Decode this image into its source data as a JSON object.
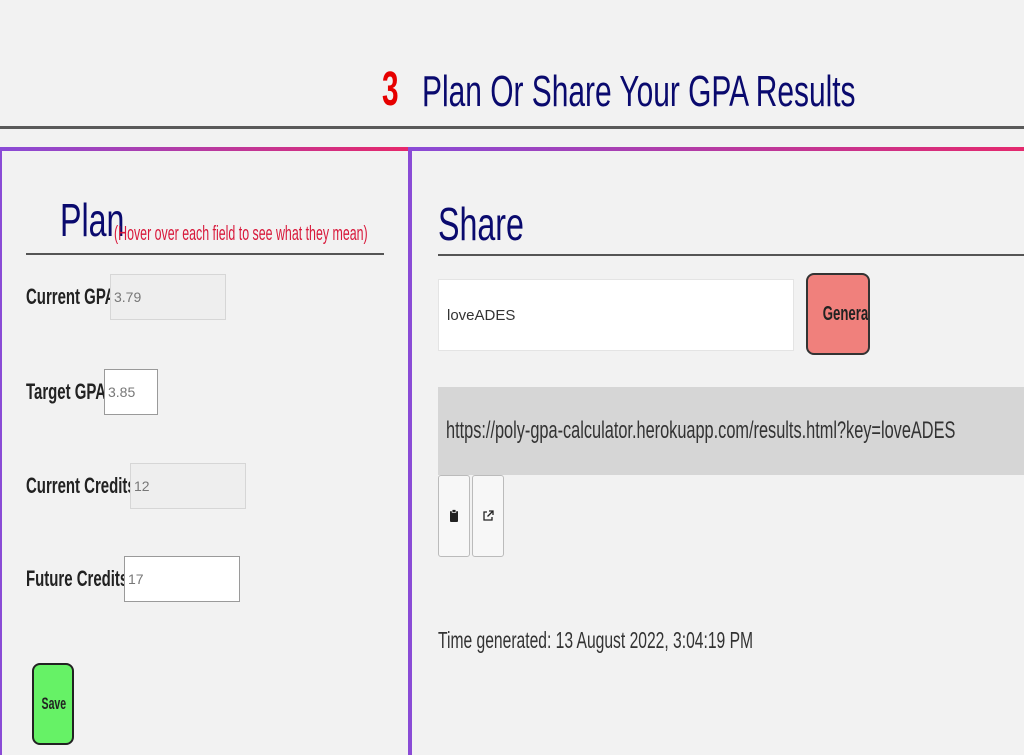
{
  "section": {
    "number": "3",
    "title": "Plan Or Share Your GPA Results"
  },
  "plan": {
    "heading": "Plan",
    "hint": "(Hover over each field to see what they mean)",
    "fields": {
      "current_gpa": {
        "label": "Current GPA:",
        "value": "3.79"
      },
      "target_gpa": {
        "label": "Target GPA:",
        "value": "3.85"
      },
      "current_credits": {
        "label": "Current Credits:",
        "value": "12"
      },
      "future_credits": {
        "label": "Future Credits:",
        "value": "17"
      }
    },
    "save_label": "Save"
  },
  "share": {
    "heading": "Share",
    "key_value": "loveADES",
    "generate_label": "Generate",
    "url": "https://poly-gpa-calculator.herokuapp.com/results.html?key=loveADES",
    "time_generated": "Time generated: 13 August 2022, 3:04:19 PM",
    "icons": {
      "copy": "clipboard-icon",
      "open": "external-link-icon"
    }
  },
  "colors": {
    "accent_number": "#e60000",
    "heading": "#0a0a6e",
    "hint": "#d8183a",
    "save": "#66f266",
    "generate": "#f0807c",
    "border_gradient_start": "#8a4bd6",
    "border_gradient_end": "#e6286b"
  }
}
